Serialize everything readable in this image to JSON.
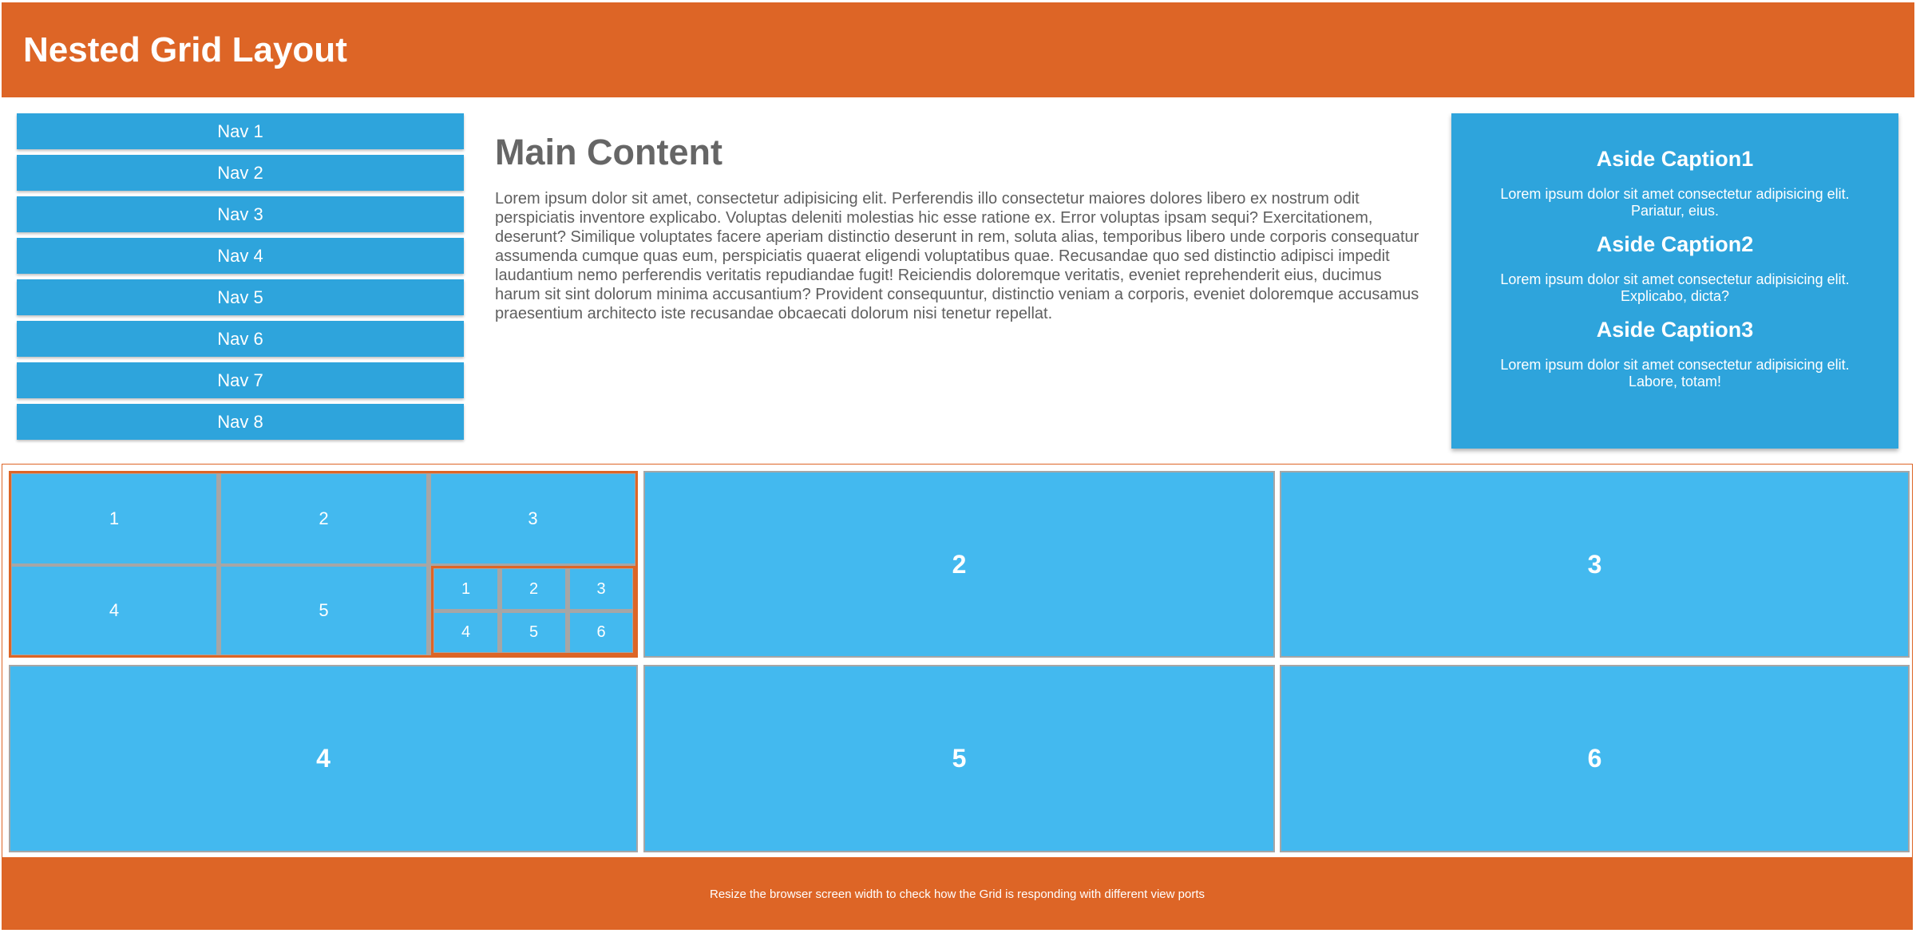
{
  "header": {
    "title": "Nested Grid Layout"
  },
  "nav": {
    "items": [
      {
        "label": "Nav 1"
      },
      {
        "label": "Nav 2"
      },
      {
        "label": "Nav 3"
      },
      {
        "label": "Nav 4"
      },
      {
        "label": "Nav 5"
      },
      {
        "label": "Nav 6"
      },
      {
        "label": "Nav 7"
      },
      {
        "label": "Nav 8"
      }
    ]
  },
  "main": {
    "title": "Main Content",
    "body": "Lorem ipsum dolor sit amet, consectetur adipisicing elit. Perferendis illo consectetur maiores dolores libero ex nostrum odit perspiciatis inventore explicabo. Voluptas deleniti molestias hic esse ratione ex. Error voluptas ipsam sequi? Exercitationem, deserunt? Similique voluptates facere aperiam distinctio deserunt in rem, soluta alias, temporibus libero unde corporis consequatur assumenda cumque quas eum, perspiciatis quaerat eligendi voluptatibus quae. Recusandae quo sed distinctio adipisci impedit laudantium nemo perferendis veritatis repudiandae fugit! Reiciendis doloremque veritatis, eveniet reprehenderit eius, ducimus harum sit sint dolorum minima accusantium? Provident consequuntur, distinctio veniam a corporis, eveniet doloremque accusamus praesentium architecto iste recusandae obcaecati dolorum nisi tenetur repellat."
  },
  "aside": {
    "captions": [
      {
        "title": "Aside Caption1",
        "text": "Lorem ipsum dolor sit amet consectetur adipisicing elit. Pariatur, eius."
      },
      {
        "title": "Aside Caption2",
        "text": "Lorem ipsum dolor sit amet consectetur adipisicing elit. Explicabo, dicta?"
      },
      {
        "title": "Aside Caption3",
        "text": "Lorem ipsum dolor sit amet consectetur adipisicing elit. Labore, totam!"
      }
    ]
  },
  "grid": {
    "nested": [
      "1",
      "2",
      "3",
      "4",
      "5"
    ],
    "nested_inner": [
      "1",
      "2",
      "3",
      "4",
      "5",
      "6"
    ],
    "cells": [
      "2",
      "3",
      "4",
      "5",
      "6"
    ]
  },
  "footer": {
    "text": "Resize the browser screen width to check how the Grid is responding with different view ports"
  },
  "colors": {
    "accent": "#dd6526",
    "primary": "#2ea4dc",
    "grid_cell": "#43b9ef"
  }
}
